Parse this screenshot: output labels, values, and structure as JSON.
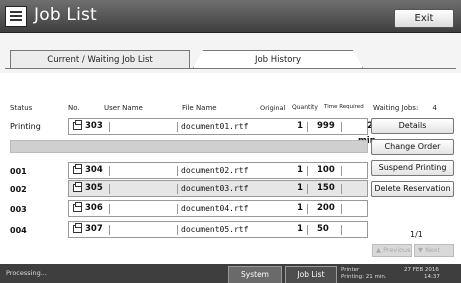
{
  "title": {
    "text": "Job List",
    "exit_label": "Exit"
  },
  "tabs": {
    "current": "Current / Waiting Job List",
    "history": "Job History"
  },
  "headers": {
    "status": "Status",
    "no": "No.",
    "user": "User Name",
    "file": "File Name",
    "original": "Original",
    "quantity": "Quantity",
    "time": "Time Required"
  },
  "waiting": {
    "label": "Waiting Jobs:",
    "count": "4"
  },
  "jobs": [
    {
      "status": "Printing",
      "no": "303",
      "file": "document01.rtf",
      "original": "1",
      "quantity": "999",
      "time": "21 min."
    },
    {
      "status": "001",
      "no": "304",
      "file": "document02.rtf",
      "original": "1",
      "quantity": "100",
      "time": ""
    },
    {
      "status": "002",
      "no": "305",
      "file": "document03.rtf",
      "original": "1",
      "quantity": "150",
      "time": ""
    },
    {
      "status": "003",
      "no": "306",
      "file": "document04.rtf",
      "original": "1",
      "quantity": "200",
      "time": ""
    },
    {
      "status": "004",
      "no": "307",
      "file": "document05.rtf",
      "original": "1",
      "quantity": "50",
      "time": ""
    }
  ],
  "actions": {
    "details": "Details",
    "change_order": "Change Order",
    "suspend": "Suspend Printing",
    "delete": "Delete Reservation"
  },
  "pagination": {
    "page": "1/1",
    "previous": "▲ Previous",
    "next": "▼ Next"
  },
  "statusbar": {
    "message": "Processing...",
    "system_status": "System Status",
    "job_list": "Job List",
    "printer_label": "Printer",
    "printing_label": "Printing: 21 min.",
    "date": "27 FEB  2016",
    "time": "14:37"
  }
}
